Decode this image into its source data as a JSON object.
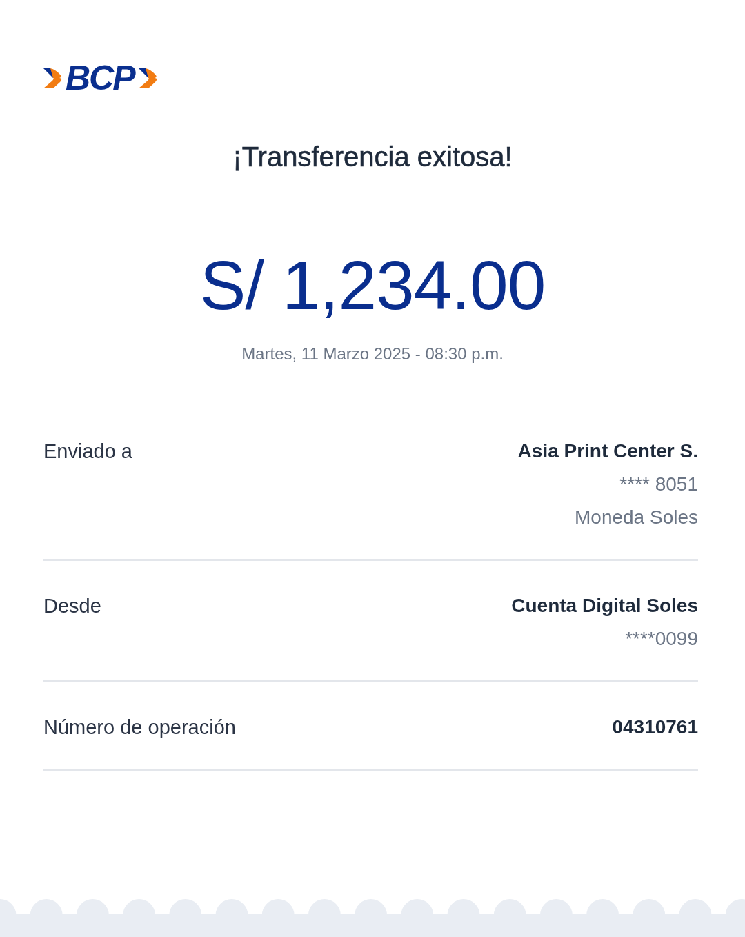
{
  "logo": {
    "text": "BCP"
  },
  "title": "¡Transferencia exitosa!",
  "amount": "S/ 1,234.00",
  "datetime": "Martes, 11 Marzo 2025 - 08:30 p.m.",
  "details": [
    {
      "label": "Enviado a",
      "values": [
        {
          "text": "Asia Print Center S.",
          "kind": "primary"
        },
        {
          "text": "**** 8051",
          "kind": "secondary"
        },
        {
          "text": "Moneda Soles",
          "kind": "secondary"
        }
      ]
    },
    {
      "label": "Desde",
      "values": [
        {
          "text": "Cuenta Digital Soles",
          "kind": "primary"
        },
        {
          "text": "****0099",
          "kind": "secondary"
        }
      ]
    },
    {
      "label": "Número de operación",
      "values": [
        {
          "text": "04310761",
          "kind": "primary"
        }
      ]
    }
  ]
}
